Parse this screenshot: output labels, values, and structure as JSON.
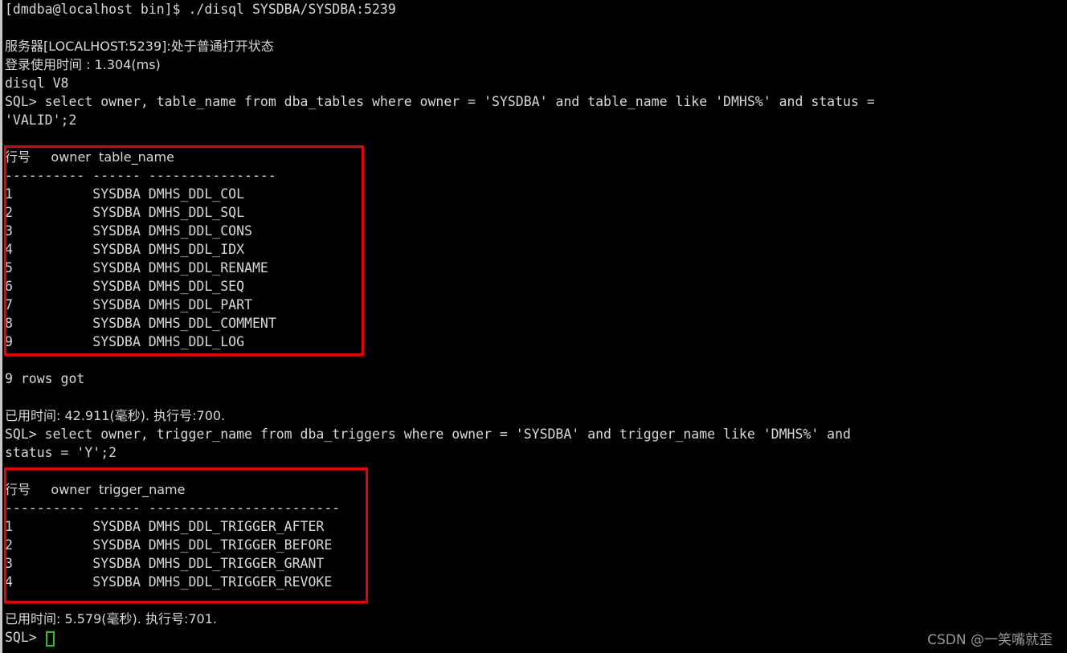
{
  "terminal": {
    "shell_prompt_line": "[dmdba@localhost bin]$ ./disql SYSDBA/SYSDBA:5239",
    "server_status_line": "服务器[LOCALHOST:5239]:处于普通打开状态",
    "login_time_line": "登录使用时间 : 1.304(ms)",
    "client_version_line": "disql V8",
    "query1_line1": "SQL> select owner, table_name from dba_tables where owner = 'SYSDBA' and table_name like 'DMHS%' and status =",
    "query1_line2": "'VALID';2",
    "rows_got_line": "9 rows got",
    "elapsed1_line": "已用时间: 42.911(毫秒). 执行号:700.",
    "query2_line1": "SQL> select owner, trigger_name from dba_triggers where owner = 'SYSDBA' and trigger_name like 'DMHS%' and",
    "query2_line2": "status = 'Y';2",
    "elapsed2_line": "已用时间: 5.579(毫秒). 执行号:701.",
    "final_prompt": "SQL> "
  },
  "result_table_1": {
    "header": "行号     owner  table_name",
    "separator": "---------- ------ ----------------",
    "rows": [
      "1          SYSDBA DMHS_DDL_COL",
      "2          SYSDBA DMHS_DDL_SQL",
      "3          SYSDBA DMHS_DDL_CONS",
      "4          SYSDBA DMHS_DDL_IDX",
      "5          SYSDBA DMHS_DDL_RENAME",
      "6          SYSDBA DMHS_DDL_SEQ",
      "7          SYSDBA DMHS_DDL_PART",
      "8          SYSDBA DMHS_DDL_COMMENT",
      "9          SYSDBA DMHS_DDL_LOG"
    ]
  },
  "result_table_2": {
    "header": "行号     owner  trigger_name",
    "separator": "---------- ------ ------------------------",
    "rows": [
      "1          SYSDBA DMHS_DDL_TRIGGER_AFTER",
      "2          SYSDBA DMHS_DDL_TRIGGER_BEFORE",
      "3          SYSDBA DMHS_DDL_TRIGGER_GRANT",
      "4          SYSDBA DMHS_DDL_TRIGGER_REVOKE"
    ]
  },
  "annotations": {
    "highlight_color": "#ee0000",
    "cursor_color": "#22c522"
  },
  "watermark": {
    "text": "CSDN @一笑嘴就歪"
  }
}
